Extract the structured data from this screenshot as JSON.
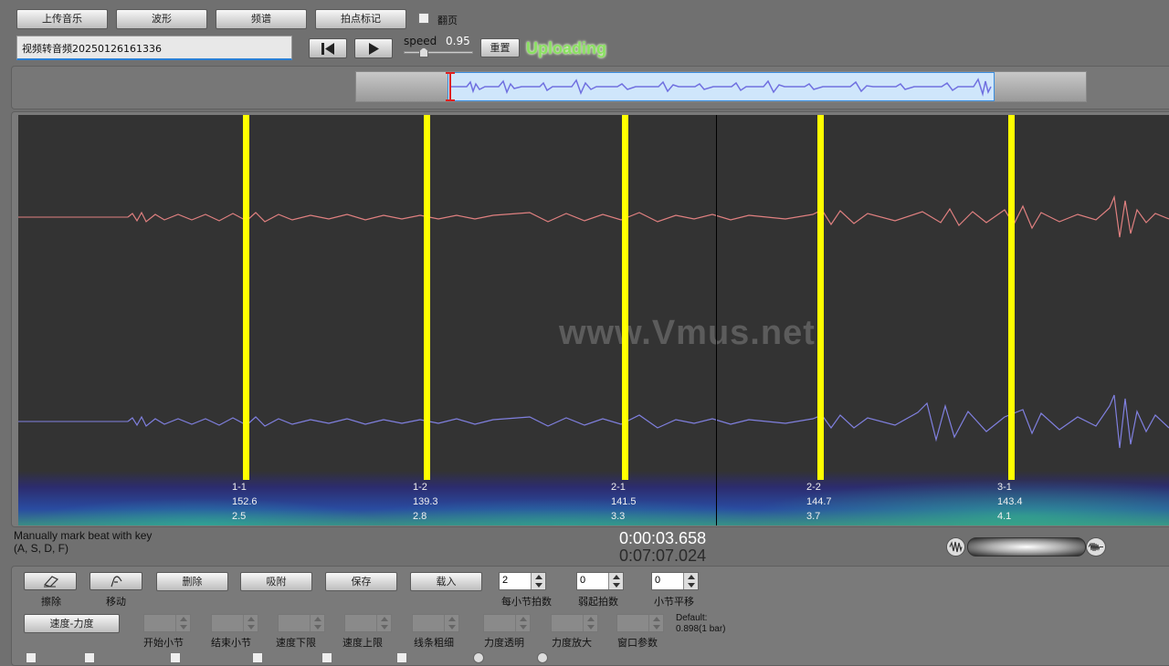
{
  "toolbar": {
    "upload_label": "上传音乐",
    "waveform_label": "波形",
    "spectrum_label": "频谱",
    "beat_mark_label": "拍点标记",
    "page_flip_label": "翻页",
    "filename": "视频转音频20250126161336",
    "speed_label": "speed",
    "speed_value": "0.95",
    "reset_label": "重置",
    "status": "Uploading"
  },
  "main": {
    "watermark": "www.Vmus.net",
    "beats": [
      {
        "label": "1-1",
        "bpm": "152.6",
        "time": "2.5"
      },
      {
        "label": "1-2",
        "bpm": "139.3",
        "time": "2.8"
      },
      {
        "label": "2-1",
        "bpm": "141.5",
        "time": "3.3"
      },
      {
        "label": "2-2",
        "bpm": "144.7",
        "time": "3.7"
      },
      {
        "label": "3-1",
        "bpm": "143.4",
        "time": "4.1"
      }
    ]
  },
  "status_bar": {
    "hint_line1": "Manually mark beat with key",
    "hint_line2": "(A, S, D, F)",
    "current_time": "0:00:03.658",
    "total_time": "0:07:07.024"
  },
  "controls": {
    "erase_label": "擦除",
    "move_label": "移动",
    "delete_label": "删除",
    "snap_label": "吸附",
    "save_label": "保存",
    "load_label": "载入",
    "beats_per_bar_value": "2",
    "beats_per_bar_label": "每小节拍数",
    "pickup_value": "0",
    "pickup_label": "弱起拍数",
    "bar_shift_value": "0",
    "bar_shift_label": "小节平移",
    "speed_force_label": "速度-力度",
    "start_bar_label": "开始小节",
    "end_bar_label": "结束小节",
    "speed_lower_label": "速度下限",
    "speed_upper_label": "速度上限",
    "line_width_label": "线条粗细",
    "force_alpha_label": "力度透明",
    "force_zoom_label": "力度放大",
    "window_param_label": "窗口参数",
    "default_label": "Default:",
    "default_value": "0.898(1 bar)"
  },
  "colors": {
    "beat_line": "#ffff00",
    "upper_wave": "#e08080",
    "lower_wave": "#8080e0",
    "status_text": "#88e060"
  }
}
